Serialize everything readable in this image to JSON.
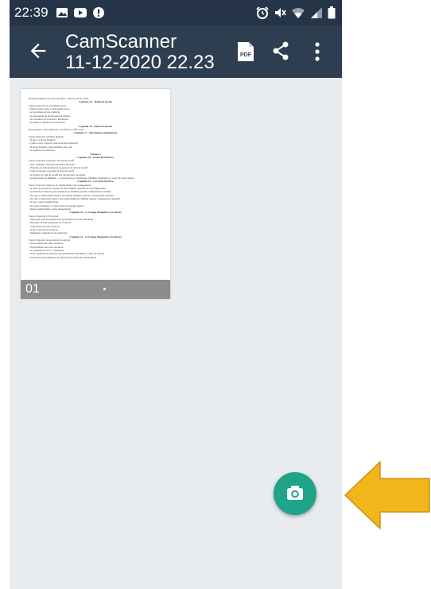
{
  "status_bar": {
    "time": "22:39",
    "left_icons": [
      "image-icon",
      "youtube-icon",
      "alert-icon"
    ],
    "right_icons": [
      "alarm-icon",
      "mute-icon",
      "wifi-icon",
      "signal-icon",
      "battery-icon"
    ]
  },
  "app_bar": {
    "title": "CamScanner",
    "subtitle": "11-12-2020 22.23",
    "pdf_label": "PDF",
    "actions": [
      "back-arrow-icon",
      "pdf-icon",
      "share-icon",
      "more-vert-icon"
    ]
  },
  "document": {
    "pages": [
      {
        "number": "01",
        "lines": [
          "Desenvolvimento do Cofre de Fisica - FIS3 ao 03-01-2020",
          "Capitulo 15 - Reflexao da luz",
          "Topico Especial: A velocidade da luz",
          "- Modos leitos sobre a velocidade da luz",
          "- A velocidade da luz e infinita",
          "- A experiencia de Ole Roemer & Fizeau",
          "- Os trabalhos de Foucault e Michelson",
          "- As maiores distancias do Universo",
          "Capitulo 16 - Refracao da luz",
          "Dois espetros, tudo explicado: da refracao a fibra otica",
          "Capitulo 17 - Movimento Ondulatorio",
          "Topico Especial: O Efeito Doppler",
          "- O que e o efeito Doppler",
          "- Como ocorre variacao observada na frequencia",
          "- O efeito Doppler como medida com a luz",
          "- A expansao do Universo",
          "Volume 3",
          "Capitulo 18 - Potencial Eletrico",
          "Topico Especial: O gerador de Van de Graaff",
          "- Alta voltagem conectada na Fisica Moderna",
          "- Principio de funcionamento do gerador de Van de Graaff",
          "- Como funciona o gerador de Van de Graaff",
          "- O gerador de Van de Graaff nos laboratorios de ensino",
          "- A experiencia de Millikan - a carga eletrica e quantizada. Millikan determinou o valor da carga eletrica",
          "Capitulo 19 - Corrente Eletrica",
          "Topico Especial: Variacao da resistividade com a temperatura",
          "- O valor da resistencia eletrica de um condutor depende de sua temperatura",
          "- A resistencia eletrica pode aumentar ou diminuir quando a temperatura aumenta",
          "- Por que a resistividade eletrica dos metais aumenta quando a temperatura aumenta",
          "- Por que a resistencia eletrica dos semicondutores diminui quando a temperatura aumenta",
          "- O que e supercondutividade",
          "- Os supercondutores e a descoberta de energia eletrica",
          "- Supercondutividade a altas temperaturas",
          "Capitulo 20 - O Campo Magnetico (1a Parte)",
          "Topico Especial: O Ciclotron",
          "- Particulas com alta energia sao necessarias na Fisica Moderna",
          "- Principio de funcionamento do ciclotron",
          "- Como funciona um ciclotron",
          "- O que e um sincrociclotron",
          "- Modernos aceleradores de particulas",
          "Capitulo 21 - O Campo Magnetico (2a Parte)",
          "Topico Especial: A descoberta do eletron",
          "- A descoberta dos raios catodicos",
          "- Propriedades dos raios catodicos",
          "- As experiencias de J. J. Thomson",
          "- Duas experiencias notaveis que permitiram determinar a carga do eletron",
          "- Evidencias experimentais da existencia de particulas subatomicas"
        ]
      }
    ]
  },
  "fab": {
    "icon": "camera-icon",
    "color": "#1fa389"
  },
  "annotation": {
    "icon": "arrow-left-icon",
    "color": "#f2b61c"
  },
  "colors": {
    "status_bar": "#253447",
    "app_bar": "#2d3e50",
    "background": "#e9ecef",
    "page_footer": "#8c8c8c"
  }
}
